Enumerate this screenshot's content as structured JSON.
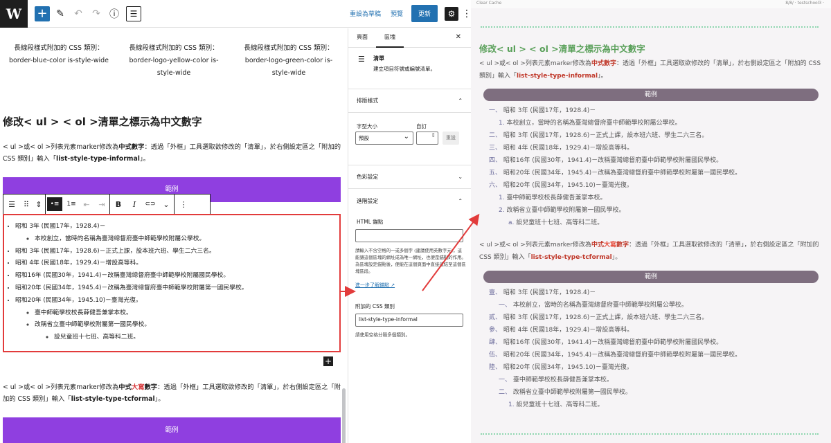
{
  "topbar": {
    "logo": "W",
    "add_icon": "+",
    "pen_icon": "✎",
    "undo_icon": "↶",
    "redo_icon": "↷",
    "info_icon": "ⓘ",
    "outline_icon": "☰",
    "save_draft": "重設為草稿",
    "preview": "預覽",
    "update": "更新",
    "settings_icon": "⚙",
    "more_icon": "⋮"
  },
  "content": {
    "columns": [
      "長線段樣式附加的 CSS 類別：border-blue-color is-style-wide",
      "長線段樣式附加的 CSS 類別：border-logo-yellow-color is-style-wide",
      "長線段樣式附加的 CSS 類別：border-logo-green-color is-style-wide"
    ],
    "heading": "修改< ul > < ol >清單之標示為中文數字",
    "para1": {
      "pre": "< ul >或< ol >列表元素marker修改為",
      "bold": "中式數字",
      "mid": "：透過「外框」工具選取欲修改的「清單」，於右側設定區之「附加的 CSS 類別」輸入「",
      "class": "list-style-type-informal",
      "post": "」。"
    },
    "example_label": "範例",
    "toolbar_icons": [
      "☰",
      "⠿",
      "⇕",
      "•≡",
      "1≡",
      "⇤",
      "⇥",
      "B",
      "I",
      "⊂⊃",
      "⌄",
      "⋮"
    ],
    "list": {
      "items": [
        {
          "text": "昭和 3年 (民國17年，1928.4)－",
          "children": [
            {
              "text": "本校創立，當時的名稱為臺灣總督府臺中師範學校附屬公學校。"
            }
          ]
        },
        {
          "text": "昭和 3年 (民國17年，1928.6)－正式上課，設本班六班、學生二六三名。"
        },
        {
          "text": "昭和 4年 (民國18年，1929.4)－增設高等科。"
        },
        {
          "text": "昭和16年 (民國30年，1941.4)－改稱臺灣總督府臺中師範學校附屬國民學校。"
        },
        {
          "text": "昭和20年 (民國34年，1945.4)－改稱為臺灣總督府臺中師範學校附屬第一國民學校。"
        },
        {
          "text": "昭和20年 (民國34年，1945.10)－臺灣光復。",
          "children": [
            {
              "text": "臺中師範學校校長薛健吾兼掌本校。"
            },
            {
              "text": "改稱省立臺中師範學校附屬第一國民學校。",
              "children": [
                {
                  "text": "設兒童班十七班、高等科二班。"
                }
              ]
            }
          ]
        }
      ]
    },
    "plus_icon": "+",
    "para2": {
      "pre": "< ul >或< ol >列表元素marker修改為",
      "bold1": "中式",
      "bold_red": "大寫",
      "bold2": "數字",
      "mid": "：透過「外框」工具選取欲修改的「清單」，於右側設定區之「附加的 CSS 類別」輸入「",
      "class": "list-style-type-tcformal",
      "post": "」。"
    }
  },
  "sidebar": {
    "tab_page": "頁面",
    "tab_block": "區塊",
    "close_icon": "✕",
    "block_icon": "☰",
    "block_title": "清單",
    "block_desc": "建立項目符號或編號清單。",
    "typography": "排版樣式",
    "font_size_label": "字型大小",
    "custom_label": "自訂",
    "font_size_value": "預設",
    "reset": "重設",
    "color": "色彩設定",
    "advanced": "進階設定",
    "html_anchor_label": "HTML 錨點",
    "anchor_help": "請輸入不含空格的一或多個字 (建議使用英數字元)，這能讓這個區塊的網址成為唯一網址，也便是錨點的作用。為區塊設定錨點後，便能在這個頁面中直接連結至這個區塊區段。",
    "learn_more": "進一步了解錨點 ↗",
    "css_class_label": "附加的 CSS 類別",
    "css_class_value": "list-style-type-informal",
    "css_class_help": "請使用空格分隔多個類別。",
    "chevron_up": "⌃",
    "chevron_down": "⌄"
  },
  "preview": {
    "topbar_left": "Clear Cache",
    "topbar_right": "8/8/ · testschool3 ·",
    "heading": "修改< ul > < ol >清單之標示為中文數字",
    "para1": {
      "pre": "< ul >或< ol >列表元素marker修改為",
      "bold": "中式數字",
      "mid": "：透過「外框」工具選取欲修改的「清單」，於右側設定區之「附加的 CSS 類別」輸入「",
      "class": "list-style-type-informal",
      "post": "」。"
    },
    "example_label": "範例",
    "list1": [
      {
        "marker": "一、",
        "text": "昭和 3年 (民國17年，1928.4)－",
        "indent": 0
      },
      {
        "marker": "1.",
        "text": "本校創立，當時的名稱為臺灣總督府臺中師範學校附屬公學校。",
        "indent": 1
      },
      {
        "marker": "二、",
        "text": "昭和 3年 (民國17年，1928.6)－正式上課，設本班六班、學生二六三名。",
        "indent": 0
      },
      {
        "marker": "三、",
        "text": "昭和 4年 (民國18年，1929.4)－增設高等科。",
        "indent": 0
      },
      {
        "marker": "四、",
        "text": "昭和16年 (民國30年，1941.4)－改稱臺灣總督府臺中師範學校附屬國民學校。",
        "indent": 0
      },
      {
        "marker": "五、",
        "text": "昭和20年 (民國34年，1945.4)－改稱為臺灣總督府臺中師範學校附屬第一國民學校。",
        "indent": 0
      },
      {
        "marker": "六、",
        "text": "昭和20年 (民國34年，1945.10)－臺灣光復。",
        "indent": 0
      },
      {
        "marker": "1.",
        "text": "臺中師範學校校長薛健吾兼掌本校。",
        "indent": 1
      },
      {
        "marker": "2.",
        "text": "改稱省立臺中師範學校附屬第一國民學校。",
        "indent": 1
      },
      {
        "marker": "a.",
        "text": "設兒童班十七班、高等科二班。",
        "indent": 2
      }
    ],
    "para2": {
      "pre": "< ul >或< ol >列表元素marker修改為",
      "bold1": "中式",
      "bold_red": "大寫",
      "bold2": "數字",
      "mid": "：透過「外框」工具選取欲修改的「清單」，於右側設定區之「附加的 CSS 類別」輸入「",
      "class": "list-style-type-tcformal",
      "post": "」。"
    },
    "list2": [
      {
        "marker": "壹、",
        "text": "昭和 3年 (民國17年，1928.4)－",
        "indent": 0
      },
      {
        "marker": "一、",
        "text": "本校創立，當時的名稱為臺灣總督府臺中師範學校附屬公學校。",
        "indent": 1
      },
      {
        "marker": "貳、",
        "text": "昭和 3年 (民國17年，1928.6)－正式上課，設本班六班、學生二六三名。",
        "indent": 0
      },
      {
        "marker": "參、",
        "text": "昭和 4年 (民國18年，1929.4)－增設高等科。",
        "indent": 0
      },
      {
        "marker": "肆、",
        "text": "昭和16年 (民國30年，1941.4)－改稱臺灣總督府臺中師範學校附屬國民學校。",
        "indent": 0
      },
      {
        "marker": "伍、",
        "text": "昭和20年 (民國34年，1945.4)－改稱為臺灣總督府臺中師範學校附屬第一國民學校。",
        "indent": 0
      },
      {
        "marker": "陸、",
        "text": "昭和20年 (民國34年，1945.10)－臺灣光復。",
        "indent": 0
      },
      {
        "marker": "一、",
        "text": "臺中師範學校校長薛健吾兼掌本校。",
        "indent": 1
      },
      {
        "marker": "二、",
        "text": "改稱省立臺中師範學校附屬第一國民學校。",
        "indent": 1
      },
      {
        "marker": "1.",
        "text": "設兒童班十七班、高等科二班。",
        "indent": 2
      }
    ]
  },
  "colors": {
    "wp_blue": "#2271b1",
    "example_purple": "#8f3fe0",
    "annotation_red": "#e23b3b",
    "preview_green": "#5aa05a",
    "preview_pill": "#7e6e7f"
  }
}
